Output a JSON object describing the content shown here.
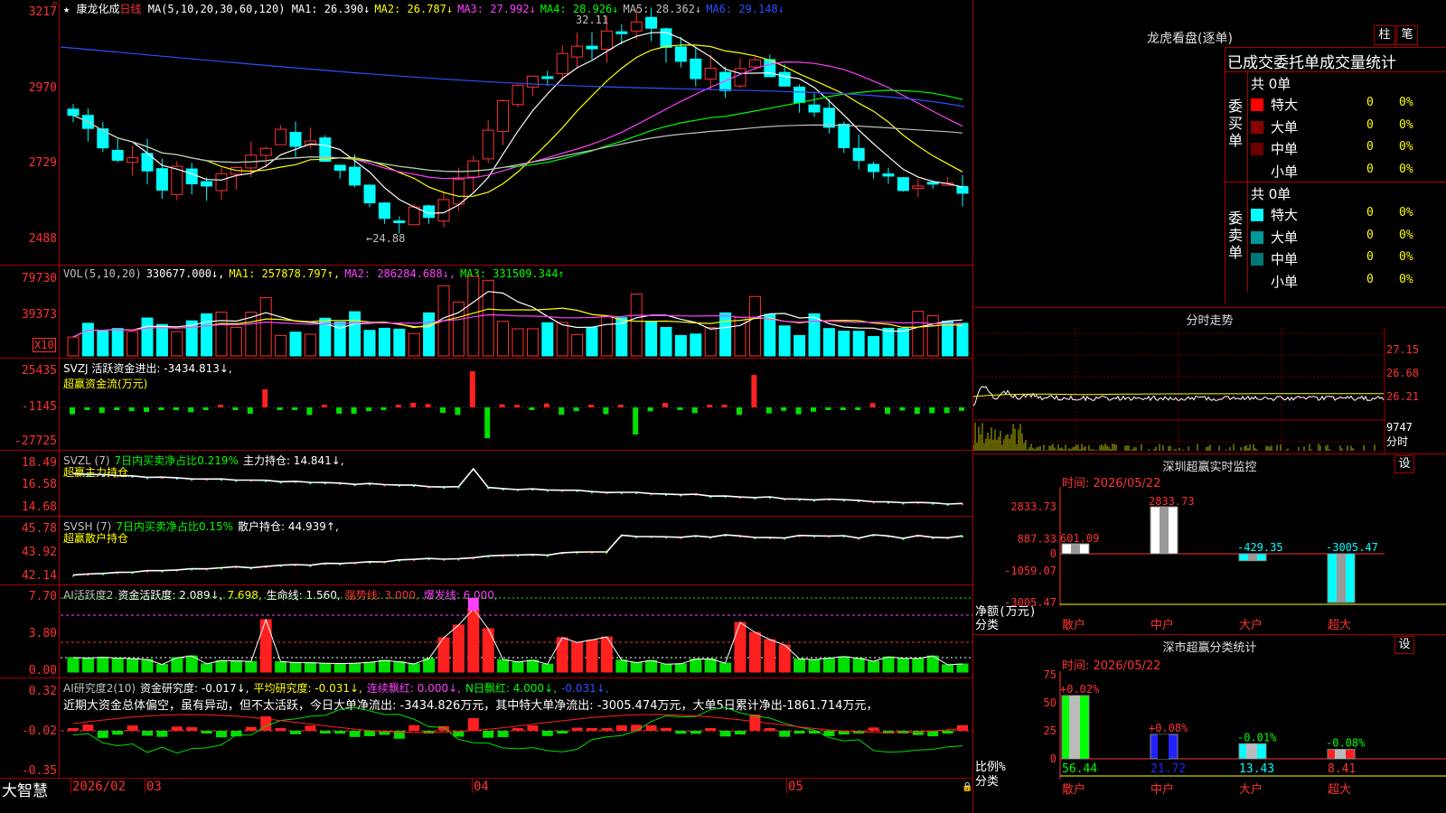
{
  "stock": {
    "name": "康龙化成",
    "period": "日线",
    "ma_label": "MA(5,10,20,30,60,120)",
    "ma": [
      {
        "label": "MA1:",
        "value": "26.390",
        "arrow": "↓",
        "color": "#ffffff"
      },
      {
        "label": "MA2:",
        "value": "26.787",
        "arrow": "↓",
        "color": "#ffff00"
      },
      {
        "label": "MA3:",
        "value": "27.992",
        "arrow": "↓",
        "color": "#ff40ff"
      },
      {
        "label": "MA4:",
        "value": "28.926",
        "arrow": "↓",
        "color": "#00ff00"
      },
      {
        "label": "MA5:",
        "value": "28.362",
        "arrow": "↓",
        "color": "#c0c0c0"
      },
      {
        "label": "MA6:",
        "value": "29.148",
        "arrow": "↓",
        "color": "#3050ff"
      }
    ],
    "price_axis": [
      "3217",
      "2970",
      "2729",
      "2488"
    ],
    "high_label": "32.11",
    "low_label": "←24.88"
  },
  "vol": {
    "header": [
      {
        "text": "VOL(5,10,20)",
        "color": "#c0c0c0"
      },
      {
        "text": "330677.000↓,",
        "color": "#ffffff"
      },
      {
        "text": "MA1: 257878.797↑,",
        "color": "#ffff00"
      },
      {
        "text": "MA2: 286284.688↓,",
        "color": "#ff40ff"
      },
      {
        "text": "MA3: 331509.344↑",
        "color": "#00ff00"
      }
    ],
    "axis": [
      "79730",
      "39373"
    ],
    "unit": "X10"
  },
  "svzj": {
    "header1": "SVZJ  活跃资金进出: -3434.813↓,",
    "header2": "超赢资金流(万元)",
    "axis": [
      "25435",
      "-1145",
      "-27725"
    ]
  },
  "svzl": {
    "header": [
      {
        "text": "SVZL (7)",
        "color": "#c0c0c0"
      },
      {
        "text": "7日内买卖净占比0.219%",
        "color": "#00ff00"
      },
      {
        "text": "主力持仓: 14.841↓,",
        "color": "#ffffff"
      }
    ],
    "header2": "超赢主力持仓",
    "axis": [
      "18.49",
      "16.58",
      "14.68"
    ]
  },
  "svsh": {
    "header": [
      {
        "text": "SVSH (7)",
        "color": "#c0c0c0"
      },
      {
        "text": "7日内买卖净占比0.15%",
        "color": "#00ff00"
      },
      {
        "text": "散户持仓: 44.939↑,",
        "color": "#ffffff"
      }
    ],
    "header2": "超赢散户持仓",
    "axis": [
      "45.78",
      "43.92",
      "42.14"
    ]
  },
  "ai": {
    "header": [
      {
        "text": "AI活跃度2",
        "color": "#c0c0c0"
      },
      {
        "text": "资金活跃度: 2.089↓,",
        "color": "#ffffff"
      },
      {
        "text": "7.698,",
        "color": "#ffff00"
      },
      {
        "text": "生命线: 1.560,",
        "color": "#ffffff"
      },
      {
        "text": "强势线: 3.000,",
        "color": "#ff3232"
      },
      {
        "text": "爆发线: 6.000,",
        "color": "#ff40ff"
      }
    ],
    "axis": [
      "7.70",
      "3.80",
      "0.00"
    ]
  },
  "research": {
    "header": [
      {
        "text": "AI研究度2(10)",
        "color": "#c0c0c0"
      },
      {
        "text": "资金研究度: -0.017↓,",
        "color": "#ffffff"
      },
      {
        "text": "平均研究度: -0.031↓,",
        "color": "#ffff00"
      },
      {
        "text": "连续飘红: 0.000↓,",
        "color": "#ff40ff"
      },
      {
        "text": "N日飘红: 4.000↓,",
        "color": "#00ff00"
      },
      {
        "text": "-0.031↓,",
        "color": "#3050ff"
      }
    ],
    "comment": "近期大资金总体偏空，虽有异动，但不太活跃，今日大单净流出: -3434.826万元，其中特大单净流出: -3005.474万元，大单5日累计净出-1861.714万元，",
    "axis": [
      "0.32",
      "-0.02",
      "-0.35"
    ]
  },
  "date_axis": {
    "brand": "大智慧",
    "labels": [
      "2026/02",
      "03",
      "04",
      "05"
    ]
  },
  "right": {
    "dragon_title": "龙虎看盘(逐单)",
    "btn_bar": "柱",
    "btn_pen": "笔",
    "order_title": "已成交委托单成交量统计",
    "buy_label": "委买单",
    "sell_label": "委卖单",
    "buy_total": "共 0单",
    "sell_total": "共 0单",
    "buy_rows": [
      {
        "name": "特大",
        "count": "0",
        "pct": "0%",
        "color": "#ff0000"
      },
      {
        "name": "大单",
        "count": "0",
        "pct": "0%",
        "color": "#8b0000"
      },
      {
        "name": "中单",
        "count": "0",
        "pct": "0%",
        "color": "#6b0000"
      },
      {
        "name": "小单",
        "count": "0",
        "pct": "0%",
        "color": ""
      }
    ],
    "sell_rows": [
      {
        "name": "特大",
        "count": "0",
        "pct": "0%",
        "color": "#00ffff"
      },
      {
        "name": "大单",
        "count": "0",
        "pct": "0%",
        "color": "#009999"
      },
      {
        "name": "中单",
        "count": "0",
        "pct": "0%",
        "color": "#007777"
      },
      {
        "name": "小单",
        "count": "0",
        "pct": "0%",
        "color": ""
      }
    ],
    "intraday_title": "分时走势",
    "intraday_axis": [
      "27.15",
      "26.68",
      "26.21",
      "9747",
      "分时"
    ],
    "monitor_title": "深圳超赢实时监控",
    "btn_set": "设",
    "monitor_time": "时间: 2026/05/22",
    "monitor_axis": [
      "2833.73",
      "887.33",
      "0",
      "-1059.07",
      "-3005.47"
    ],
    "monitor_unit": "净额(万元)",
    "category_label": "分类",
    "categories": [
      "散户",
      "中户",
      "大户",
      "超大"
    ],
    "monitor_values": [
      601.09,
      2833.73,
      -429.35,
      -3005.47
    ],
    "monitor_value_labels": [
      "601.09",
      "2833.73",
      "-429.35",
      "-3005.47"
    ],
    "class_title": "深市超赢分类统计",
    "class_time": "时间: 2026/05/22",
    "class_axis": [
      "75",
      "50",
      "25",
      "0"
    ],
    "class_unit": "比例%",
    "class_values": [
      56.44,
      21.72,
      13.43,
      8.41
    ],
    "class_value_labels": [
      "56.44",
      "21.72",
      "13.43",
      "8.41"
    ],
    "class_changes": [
      "+0.02%",
      "+0.08%",
      "-0.01%",
      "-0.08%"
    ]
  }
}
